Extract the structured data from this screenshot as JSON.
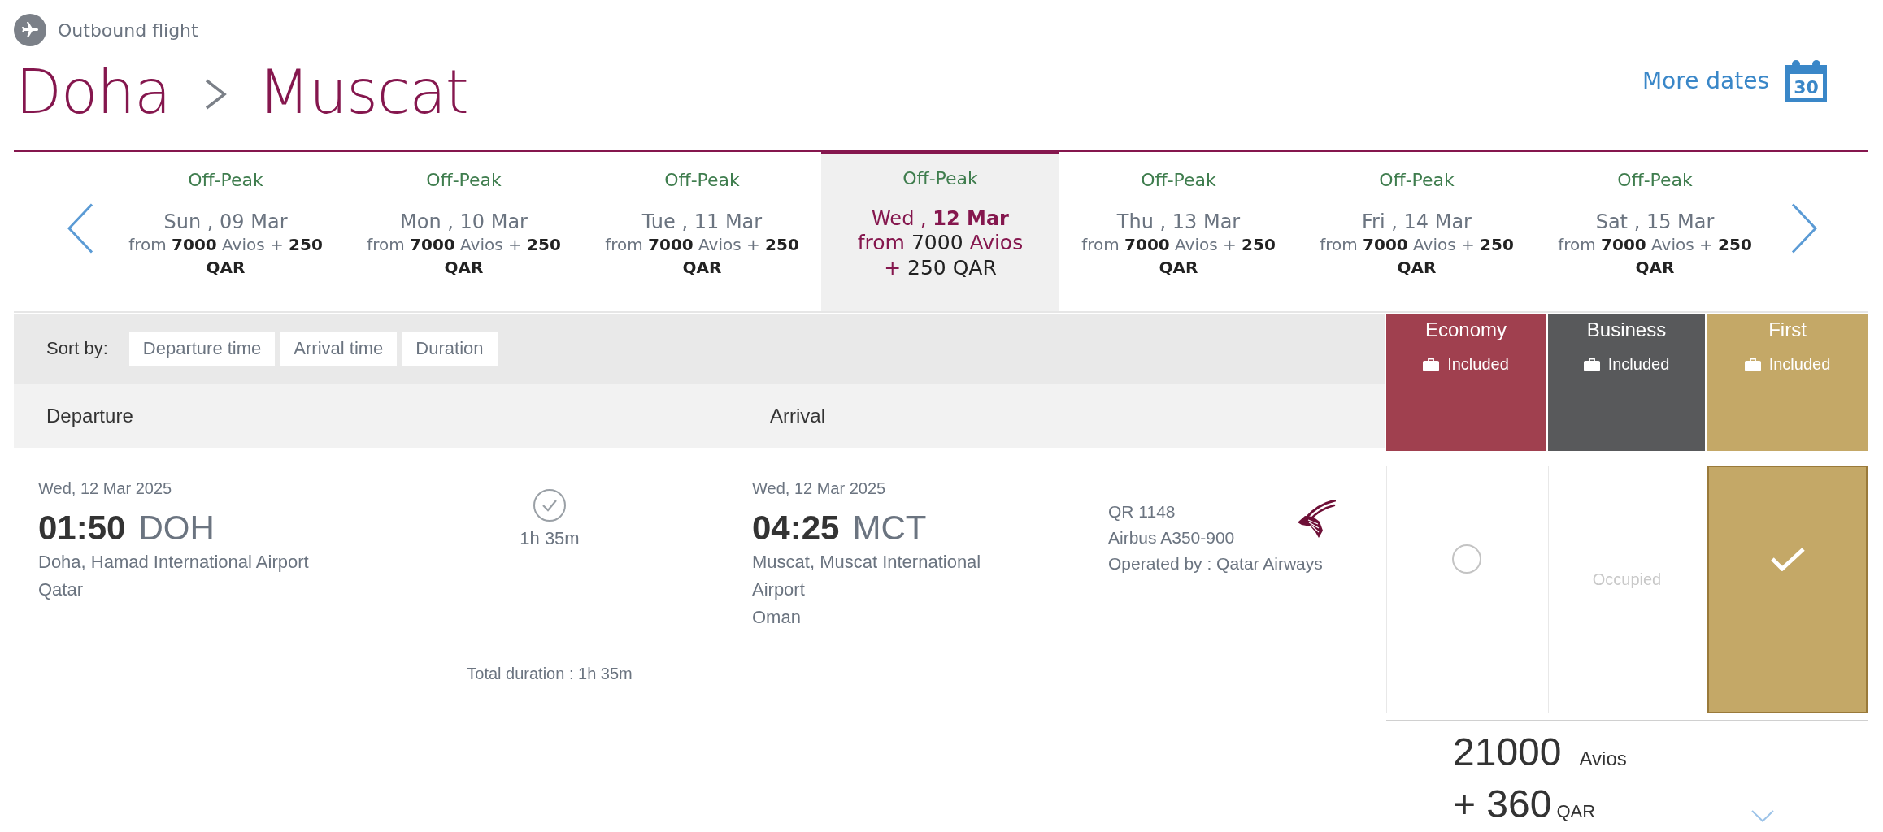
{
  "header": {
    "section_label": "Outbound flight",
    "origin": "Doha",
    "destination": "Muscat",
    "more_dates": "More dates",
    "calendar_day": "30"
  },
  "date_strip": {
    "days": [
      {
        "peak": "Off-Peak",
        "date": "Sun , 09 Mar",
        "price": "from **7000** Avios + **250 QAR**",
        "selected": false
      },
      {
        "peak": "Off-Peak",
        "date": "Mon , 10 Mar",
        "price": "from **7000** Avios + **250 QAR**",
        "selected": false
      },
      {
        "peak": "Off-Peak",
        "date": "Tue , 11 Mar",
        "price": "from **7000** Avios + **250 QAR**",
        "selected": false
      },
      {
        "peak": "Off-Peak",
        "date": "Wed , **12 Mar**",
        "price": "from **7000** Avios + **250 QAR**",
        "selected": true
      },
      {
        "peak": "Off-Peak",
        "date": "Thu , 13 Mar",
        "price": "from **7000** Avios + **250 QAR**",
        "selected": false
      },
      {
        "peak": "Off-Peak",
        "date": "Fri , 14 Mar",
        "price": "from **7000** Avios + **250 QAR**",
        "selected": false
      },
      {
        "peak": "Off-Peak",
        "date": "Sat , 15 Mar",
        "price": "from **7000** Avios + **250 QAR**",
        "selected": false
      }
    ]
  },
  "sort": {
    "label": "Sort by:",
    "options": [
      {
        "label": "Departure time",
        "selected": false
      },
      {
        "label": "Arrival time",
        "selected": false
      },
      {
        "label": "Duration",
        "selected": false
      }
    ]
  },
  "columns": [
    "Departure",
    "Arrival"
  ],
  "flight": {
    "departure": {
      "date": "Wed, 12 Mar 2025",
      "time": "01:50",
      "code": "DOH",
      "airport": "Doha, Hamad International Airport",
      "country": "Qatar"
    },
    "duration": "1h 35m",
    "arrival": {
      "date": "Wed, 12 Mar 2025",
      "time": "04:25",
      "code": "MCT",
      "airport": "Muscat, Muscat International Airport",
      "country": "Oman"
    },
    "flight_number": "QR 1148",
    "aircraft": "Airbus A350-900",
    "operator": "Operated by : Qatar Airways",
    "total_duration": "Total duration : 1h 35m"
  },
  "cabins": [
    {
      "name": "Economy",
      "baggage": "Included",
      "color": "#a0404f",
      "option": {
        "kind": "radio",
        "selected": false
      }
    },
    {
      "name": "Business",
      "baggage": "Included",
      "color": "#58595b",
      "option": {
        "kind": "unavailable",
        "label": "Occupied",
        "selected": false
      }
    },
    {
      "name": "First",
      "baggage": "Included",
      "color": "#c4a867",
      "option": {
        "kind": "radio",
        "selected": true
      }
    }
  ],
  "total": {
    "avios": "21000",
    "avios_unit": "Avios",
    "cash": "+ 360",
    "currency": "QAR"
  }
}
